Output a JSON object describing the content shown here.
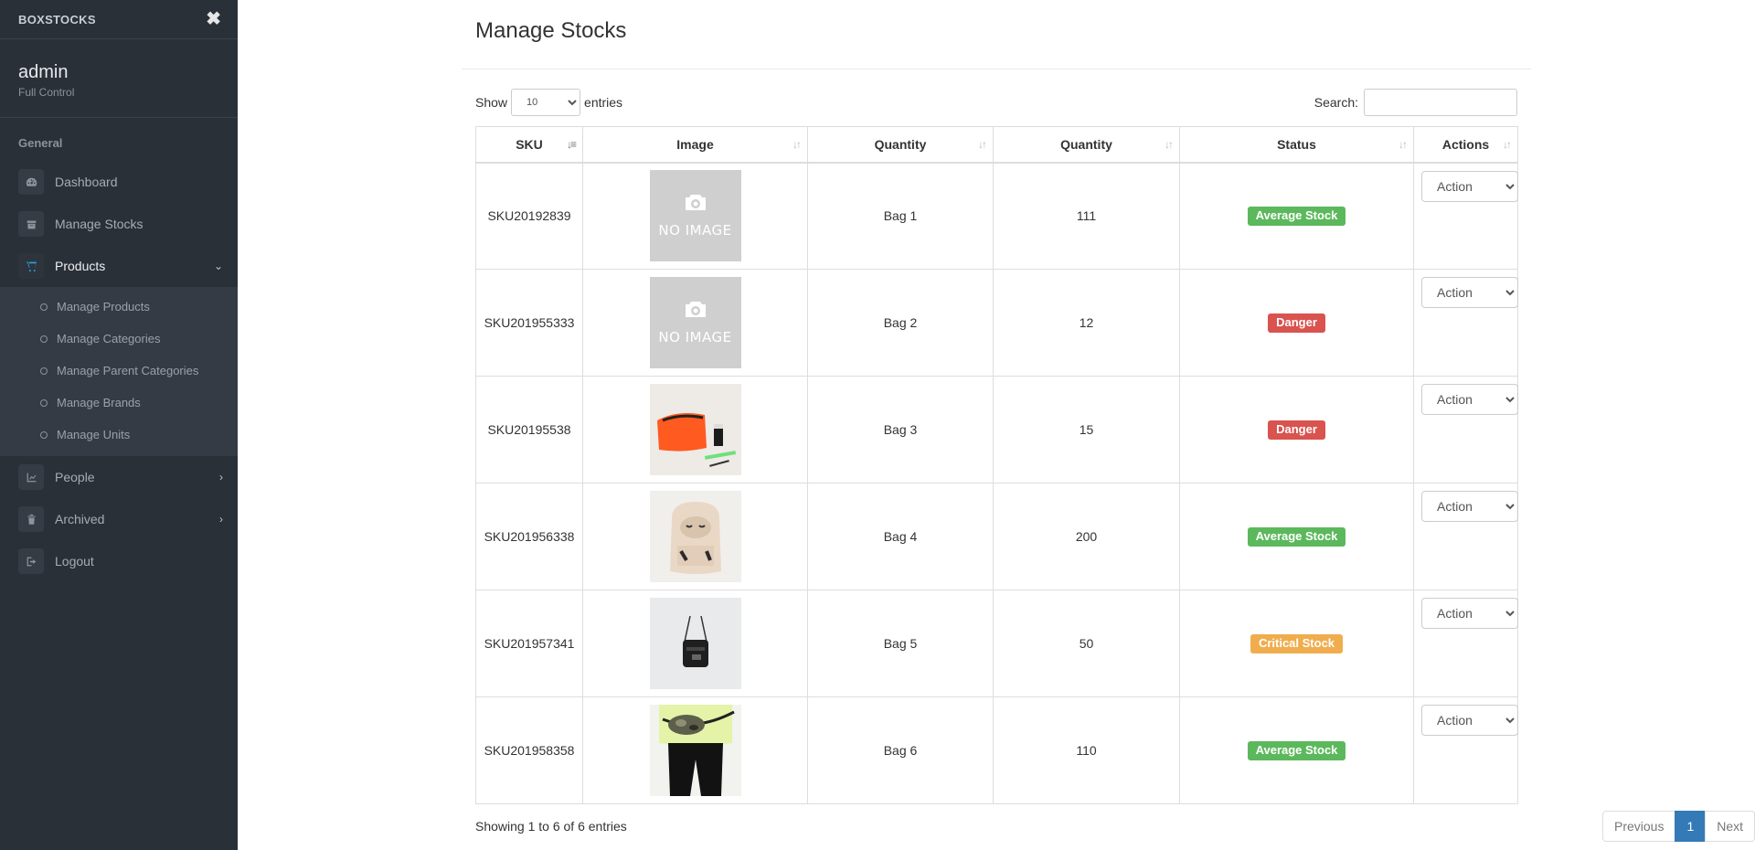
{
  "sidebar": {
    "brand": "BOXSTOCKS",
    "close_symbol": "✖",
    "user": {
      "name": "admin",
      "role": "Full Control"
    },
    "section_title": "General",
    "nav": {
      "dashboard": {
        "label": "Dashboard",
        "icon": "dashboard-icon"
      },
      "manage_stocks": {
        "label": "Manage Stocks",
        "icon": "box-icon"
      },
      "products": {
        "label": "Products",
        "icon": "cart-icon",
        "caret": "⌄"
      },
      "people": {
        "label": "People",
        "icon": "chart-icon",
        "caret": "›"
      },
      "archived": {
        "label": "Archived",
        "icon": "trash-icon",
        "caret": "›"
      },
      "logout": {
        "label": "Logout",
        "icon": "sign-out-icon"
      }
    },
    "products_sub": [
      "Manage Products",
      "Manage Categories",
      "Manage Parent Categories",
      "Manage Brands",
      "Manage Units"
    ]
  },
  "page": {
    "title": "Manage Stocks"
  },
  "controls": {
    "show_label": "Show",
    "entries_value": "10",
    "entries_label": "entries",
    "search_label": "Search:",
    "search_value": ""
  },
  "table": {
    "headers": {
      "sku": "SKU",
      "image": "Image",
      "quantity_1": "Quantity",
      "quantity_2": "Quantity",
      "status": "Status",
      "actions": "Actions"
    },
    "no_image_text": "NO IMAGE",
    "action_label": "Action",
    "rows": [
      {
        "sku": "SKU20192839",
        "image": "no-image",
        "name": "Bag 1",
        "qty": "111",
        "status": "Average Stock",
        "status_color": "#5cb85c"
      },
      {
        "sku": "SKU201955333",
        "image": "no-image",
        "name": "Bag 2",
        "qty": "12",
        "status": "Danger",
        "status_color": "#d9534f"
      },
      {
        "sku": "SKU20195538",
        "image": "orange-pouch",
        "name": "Bag 3",
        "qty": "15",
        "status": "Danger",
        "status_color": "#d9534f"
      },
      {
        "sku": "SKU201956338",
        "image": "sloth-backpack",
        "name": "Bag 4",
        "qty": "200",
        "status": "Average Stock",
        "status_color": "#5cb85c"
      },
      {
        "sku": "SKU201957341",
        "image": "black-crossbody-bag",
        "name": "Bag 5",
        "qty": "50",
        "status": "Critical Stock",
        "status_color": "#f0ad4e"
      },
      {
        "sku": "SKU201958358",
        "image": "camo-belt-bag",
        "name": "Bag 6",
        "qty": "110",
        "status": "Average Stock",
        "status_color": "#5cb85c"
      }
    ]
  },
  "footer": {
    "info": "Showing 1 to 6 of 6 entries",
    "prev": "Previous",
    "current_page": "1",
    "next": "Next"
  }
}
